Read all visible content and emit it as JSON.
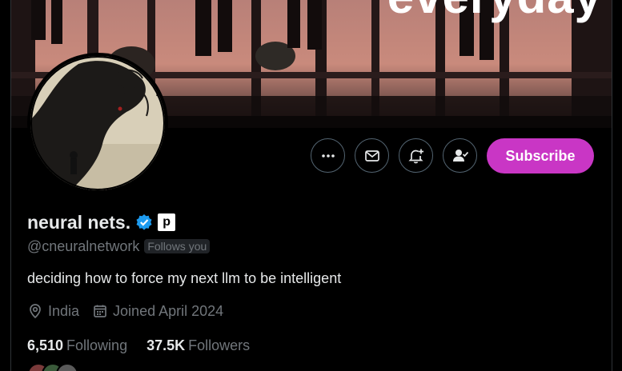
{
  "banner": {
    "text": "everyday"
  },
  "actions": {
    "more_icon": "more-horizontal-icon",
    "message_icon": "envelope-icon",
    "notify_icon": "bell-plus-icon",
    "following_icon": "person-check-icon",
    "subscribe_label": "Subscribe"
  },
  "profile": {
    "display_name": "neural nets.",
    "verified_icon": "verified-badge-icon",
    "affiliate_badge": "p",
    "handle": "@cneuralnetwork",
    "follows_you_label": "Follows you",
    "bio": "deciding how to force my next llm to be intelligent",
    "location": "India",
    "joined": "Joined April 2024",
    "following_count": "6,510",
    "following_label": "Following",
    "followers_count": "37.5K",
    "followers_label": "Followers"
  },
  "colors": {
    "background": "#000000",
    "subscribe_bg": "#c936c5",
    "verified_blue": "#1d9bf0",
    "muted_text": "#71767b",
    "primary_text": "#e7e9ea",
    "button_border": "#536471"
  }
}
